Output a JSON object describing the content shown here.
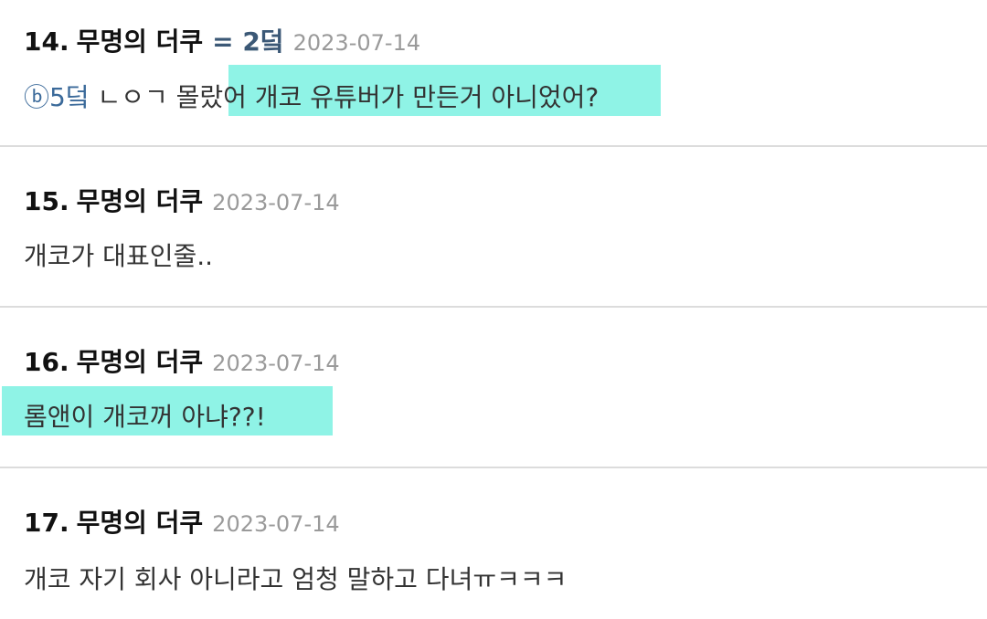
{
  "comments": [
    {
      "number": "14.",
      "author": "무명의 더쿠",
      "reply_to": "= 2덬",
      "date": "2023-07-14",
      "mention": "ⓑ5덬",
      "text_before_highlight": " ㄴㅇㄱ 몰랐어",
      "highlighted_text": " 개코 유튜버가 만든거 아니었어?"
    },
    {
      "number": "15.",
      "author": "무명의 더쿠",
      "date": "2023-07-14",
      "text": "개코가 대표인줄.."
    },
    {
      "number": "16.",
      "author": "무명의 더쿠",
      "date": "2023-07-14",
      "highlighted_text": "롬앤이 개코꺼 아냐??!"
    },
    {
      "number": "17.",
      "author": "무명의 더쿠",
      "date": "2023-07-14",
      "text": "개코 자기 회사 아니라고 엄청 말하고 다녀ㅠㅋㅋㅋ"
    }
  ],
  "colors": {
    "highlight": "#8ff3e6",
    "reply_to": "#3b5876",
    "mention": "#3b6a9a",
    "date": "#9a9a9a",
    "divider": "#dcdcdc"
  }
}
